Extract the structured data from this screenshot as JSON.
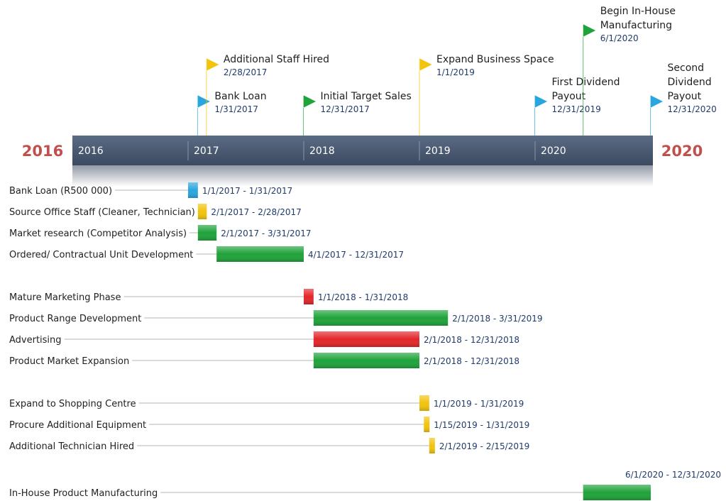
{
  "chart_data": {
    "type": "timeline-gantt",
    "start_label": "2016",
    "end_label": "2020",
    "axis_ticks": [
      "2016",
      "2017",
      "2018",
      "2019",
      "2020"
    ],
    "milestones": [
      {
        "title": [
          "Bank Loan"
        ],
        "date": "1/31/2017",
        "color": "#2aa6df"
      },
      {
        "title": [
          "Additional Staff Hired"
        ],
        "date": "2/28/2017",
        "color": "#f2c40c"
      },
      {
        "title": [
          "Initial Target Sales"
        ],
        "date": "12/31/2017",
        "color": "#1fa33a"
      },
      {
        "title": [
          "Expand Business Space"
        ],
        "date": "1/1/2019",
        "color": "#f2c40c"
      },
      {
        "title": [
          "First Dividend",
          "Payout"
        ],
        "date": "12/31/2019",
        "color": "#2aa6df"
      },
      {
        "title": [
          "Begin In-House",
          "Manufacturing"
        ],
        "date": "6/1/2020",
        "color": "#1fa33a"
      },
      {
        "title": [
          "Second",
          "Dividend",
          "Payout"
        ],
        "date": "12/31/2020",
        "color": "#2aa6df"
      }
    ],
    "groups": [
      [
        {
          "name": "Bank Loan (R500 000)",
          "start": "1/1/2017",
          "end": "1/31/2017",
          "color": "#2aa6df"
        },
        {
          "name": "Source Office Staff (Cleaner, Technician)",
          "start": "2/1/2017",
          "end": "2/28/2017",
          "color": "#f2c40c"
        },
        {
          "name": "Market research (Competitor Analysis)",
          "start": "2/1/2017",
          "end": "3/31/2017",
          "color": "#1fa33a"
        },
        {
          "name": "Ordered/ Contractual Unit Development",
          "start": "4/1/2017",
          "end": "12/31/2017",
          "color": "#1fa33a"
        }
      ],
      [
        {
          "name": "Mature Marketing Phase",
          "start": "1/1/2018",
          "end": "1/31/2018",
          "color": "#e3262b"
        },
        {
          "name": "Product Range Development",
          "start": "2/1/2018",
          "end": "3/31/2019",
          "color": "#1fa33a"
        },
        {
          "name": "Advertising",
          "start": "2/1/2018",
          "end": "12/31/2018",
          "color": "#e3262b"
        },
        {
          "name": "Product Market Expansion",
          "start": "2/1/2018",
          "end": "12/31/2018",
          "color": "#1fa33a"
        }
      ],
      [
        {
          "name": "Expand to Shopping Centre",
          "start": "1/1/2019",
          "end": "1/31/2019",
          "color": "#f2c40c"
        },
        {
          "name": "Procure Additional Equipment",
          "start": "1/15/2019",
          "end": "1/31/2019",
          "color": "#f2c40c"
        },
        {
          "name": "Additional Technician Hired",
          "start": "2/1/2019",
          "end": "2/15/2019",
          "color": "#f2c40c"
        }
      ],
      [
        {
          "name": "In-House Product Manufacturing",
          "start": "6/1/2020",
          "end": "12/31/2020",
          "color": "#1fa33a"
        }
      ]
    ],
    "range_separator": " - "
  }
}
